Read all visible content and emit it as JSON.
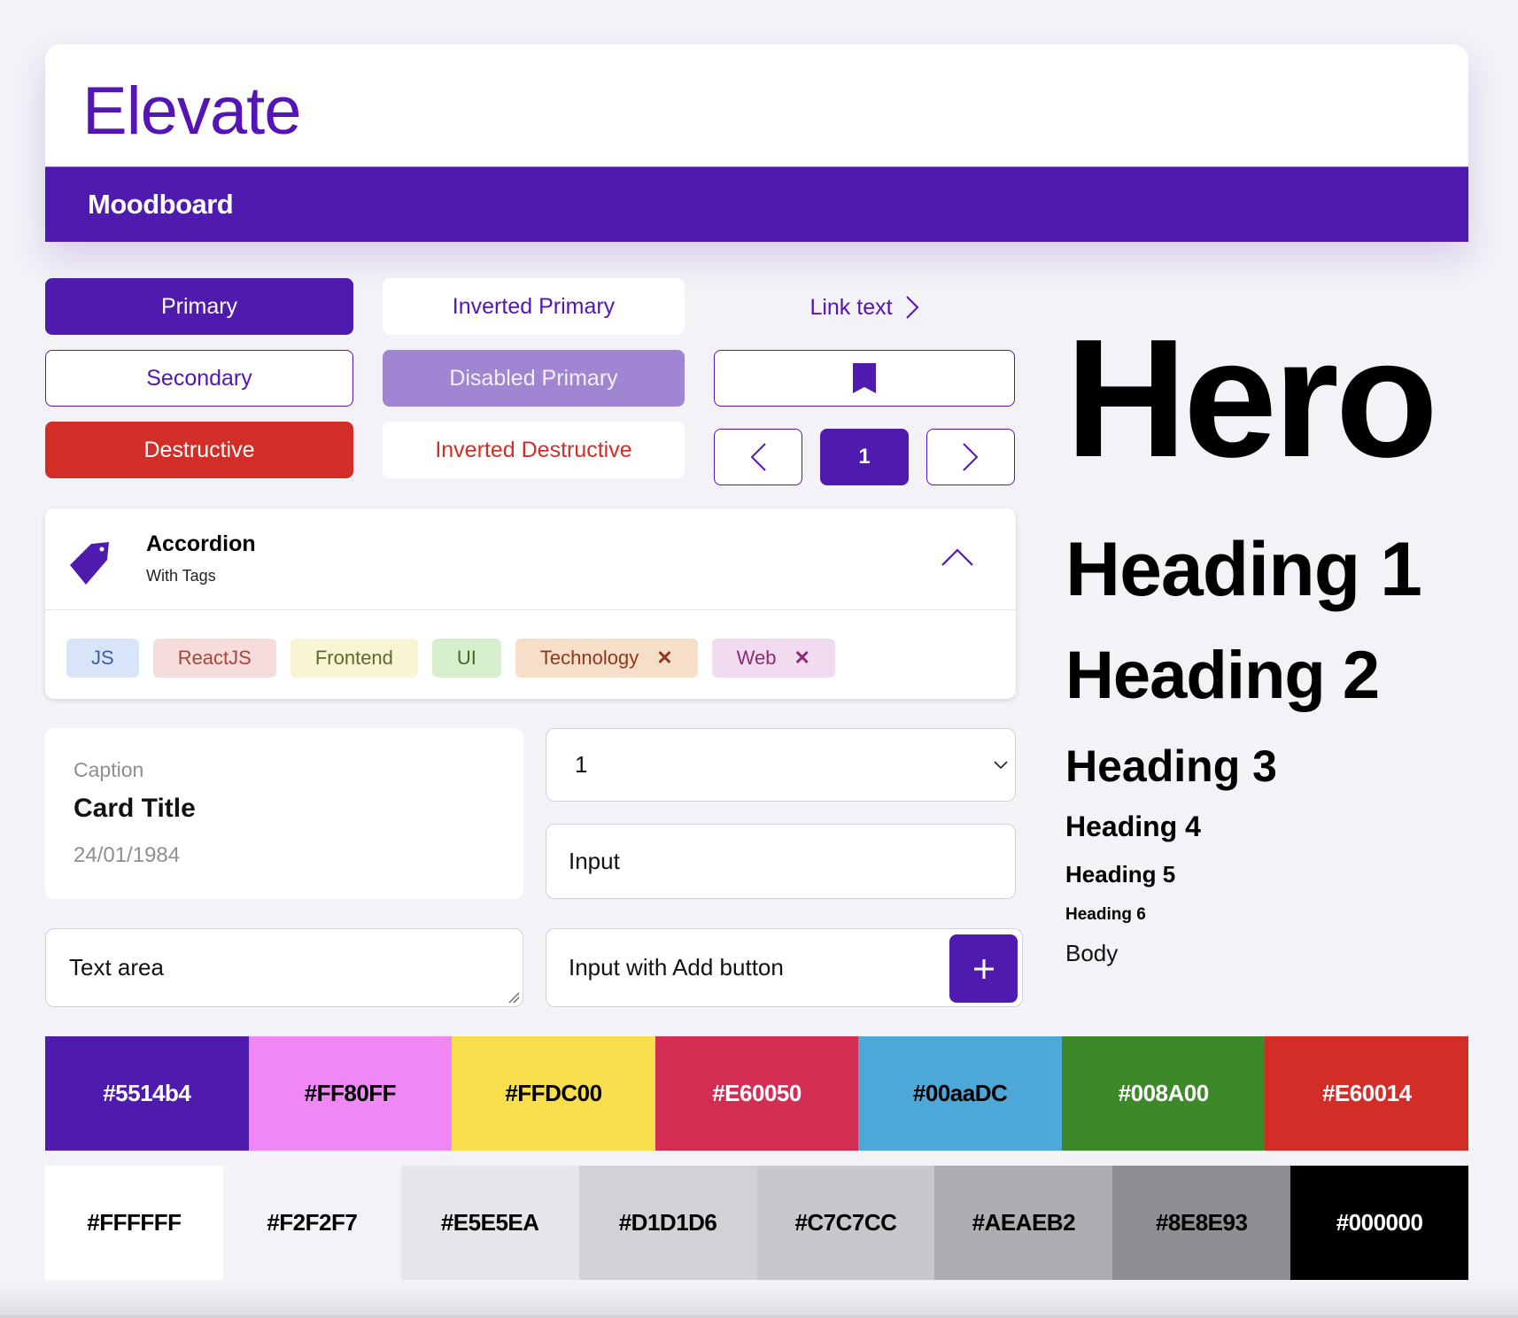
{
  "header": {
    "brand": "Elevate",
    "nav_title": "Moodboard"
  },
  "buttons": {
    "primary": "Primary",
    "secondary": "Secondary",
    "destructive": "Destructive",
    "inverted_primary": "Inverted Primary",
    "disabled_primary": "Disabled Primary",
    "inverted_destructive": "Inverted Destructive",
    "link_text": "Link text",
    "bookmark_icon": "bookmark-icon"
  },
  "pagination": {
    "prev_icon": "chevron-left-icon",
    "current_page": "1",
    "next_icon": "chevron-right-icon"
  },
  "accordion": {
    "icon": "tag-icon",
    "title": "Accordion",
    "subtitle": "With Tags",
    "expanded": true,
    "tags": [
      {
        "label": "JS",
        "removable": false,
        "bg": "#d8e4f8",
        "fg": "#3c5fa8"
      },
      {
        "label": "ReactJS",
        "removable": false,
        "bg": "#f6dcda",
        "fg": "#a4473d"
      },
      {
        "label": "Frontend",
        "removable": false,
        "bg": "#f8f5d2",
        "fg": "#5c6a2a"
      },
      {
        "label": "UI",
        "removable": false,
        "bg": "#d8efcd",
        "fg": "#3e6b2a"
      },
      {
        "label": "Technology",
        "removable": true,
        "bg": "#f7dec9",
        "fg": "#8a3a1a"
      },
      {
        "label": "Web",
        "removable": true,
        "bg": "#f1dbee",
        "fg": "#8e2a78"
      }
    ],
    "remove_glyph": "✕"
  },
  "card": {
    "caption": "Caption",
    "title": "Card Title",
    "date": "24/01/1984"
  },
  "form": {
    "textarea_value": "Text area",
    "select_value": "1",
    "input_value": "Input",
    "input_add_value": "Input with Add button",
    "add_icon": "plus-icon"
  },
  "typography": {
    "hero": "Hero",
    "h1": "Heading 1",
    "h2": "Heading 2",
    "h3": "Heading 3",
    "h4": "Heading 4",
    "h5": "Heading 5",
    "h6": "Heading 6",
    "body": "Body"
  },
  "palette": {
    "brand": [
      {
        "hex": "#5514b4",
        "bg": "#4f1aae",
        "text": "#ffffff"
      },
      {
        "hex": "#FF80FF",
        "bg": "#ef87f4",
        "text": "#000000"
      },
      {
        "hex": "#FFDC00",
        "bg": "#f8dd4c",
        "text": "#000000"
      },
      {
        "hex": "#E60050",
        "bg": "#d42d53",
        "text": "#ffffff"
      },
      {
        "hex": "#00aaDC",
        "bg": "#4da7d7",
        "text": "#000000"
      },
      {
        "hex": "#008A00",
        "bg": "#3d8828",
        "text": "#ffffff"
      },
      {
        "hex": "#E60014",
        "bg": "#d22d27",
        "text": "#ffffff"
      }
    ],
    "neutral": [
      {
        "hex": "#FFFFFF",
        "bg": "#ffffff",
        "text": "#000000"
      },
      {
        "hex": "#F2F2F7",
        "bg": "#F2F2F7",
        "text": "#000000"
      },
      {
        "hex": "#E5E5EA",
        "bg": "#E5E5EA",
        "text": "#000000"
      },
      {
        "hex": "#D1D1D6",
        "bg": "#D1D1D6",
        "text": "#000000"
      },
      {
        "hex": "#C7C7CC",
        "bg": "#C7C7CC",
        "text": "#000000"
      },
      {
        "hex": "#AEAEB2",
        "bg": "#AEAEB2",
        "text": "#000000"
      },
      {
        "hex": "#8E8E93",
        "bg": "#8E8E93",
        "text": "#000000"
      },
      {
        "hex": "#000000",
        "bg": "#000000",
        "text": "#ffffff"
      }
    ]
  }
}
